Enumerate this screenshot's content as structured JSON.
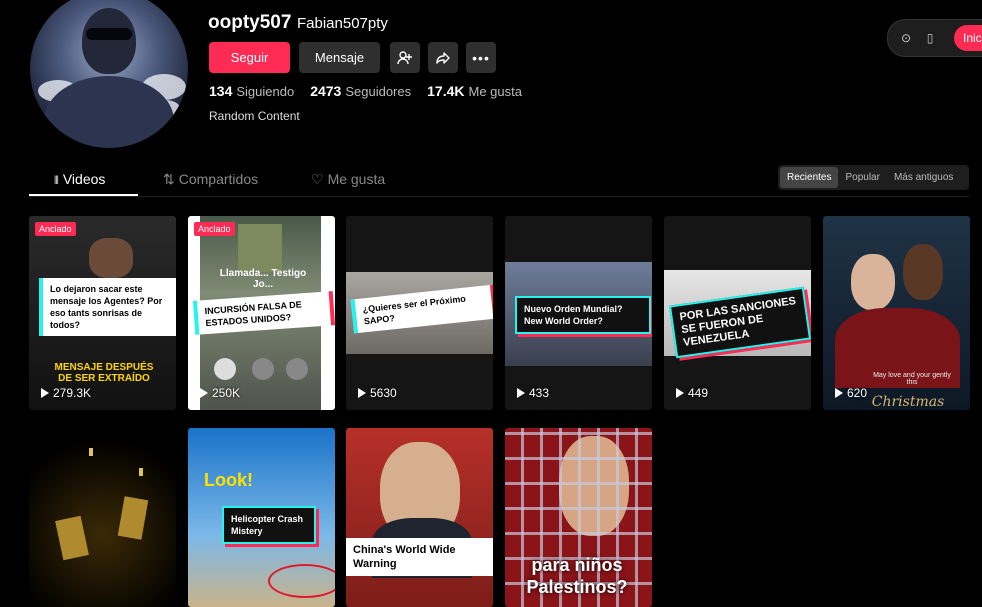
{
  "profile": {
    "username": "oopty507",
    "nickname": "Fabian507pty",
    "follow_label": "Seguir",
    "message_label": "Mensaje",
    "following_count": "134",
    "following_label": "Siguiendo",
    "followers_count": "2473",
    "followers_label": "Seguidores",
    "likes_count": "17.4K",
    "likes_label": "Me gusta",
    "bio": "Random Content"
  },
  "topbar": {
    "login_label": "Inici"
  },
  "tabs": [
    {
      "label": "Videos",
      "icon": "grid-icon"
    },
    {
      "label": "Compartidos",
      "icon": "repost-icon"
    },
    {
      "label": "Me gusta",
      "icon": "heart-outline-icon"
    }
  ],
  "sort_options": [
    "Recientes",
    "Popular",
    "Más antiguos"
  ],
  "colors": {
    "accent": "#fe2c55",
    "cyan": "#25f4ee"
  },
  "videos": [
    {
      "badge": "Anclado",
      "views": "279.3K",
      "caption": "Lo dejaron sacar este mensaje los Agentes? Por eso tants sonrisas de todos?",
      "overlay": "MENSAJE DESPUÉS DE SER EXTRAÍDO"
    },
    {
      "badge": "Anclado",
      "views": "250K",
      "caption": "INCURSIÓN FALSA DE ESTADOS UNIDOS?",
      "overlay": "Llamada... Testigo Jo..."
    },
    {
      "views": "5630",
      "caption": "¿Quieres ser el Próximo SAPO?"
    },
    {
      "views": "433",
      "caption": "Nuevo Orden Mundial? New World Order?"
    },
    {
      "views": "449",
      "caption": "POR LAS SANCIONES SE FUERON DE VENEZUELA"
    },
    {
      "views": "620",
      "overlay": "May love and your gently this",
      "overlay2": "Christmas"
    },
    {
      "views": "",
      "caption": ""
    },
    {
      "views": "",
      "caption": "Helicopter Crash Mistery",
      "overlay": "Look!"
    },
    {
      "views": "",
      "caption": "China's World Wide Warning"
    },
    {
      "views": "",
      "overlay": "para niños Palestinos?"
    }
  ]
}
